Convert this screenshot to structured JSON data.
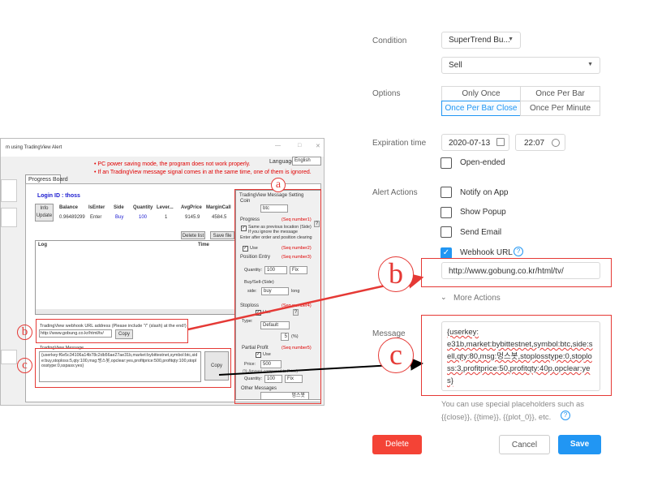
{
  "app": {
    "window_title": "m using TradingView Alert",
    "language_label": "Language:",
    "language_value": "English",
    "warnings": [
      "• PC power saving mode, the program does not work properly.",
      "• If an TradingView message signal comes in at the same time, one of them is ignored."
    ],
    "tab": "Progress Board",
    "login": "Login ID : thoss",
    "info_update": "Info\nUpdate",
    "columns": [
      "Balance",
      "IsEnter",
      "Side",
      "Quantity",
      "Lever...",
      "AvgPrice",
      "MarginCall"
    ],
    "row": [
      "0.96489299",
      "Enter",
      "Buy",
      "100",
      "1",
      "9145.9",
      "4584.5"
    ],
    "delete_list": "Delete list",
    "save_file": "Save file",
    "log_header": "Log",
    "time_header": "Time",
    "webhook_label": "TradingView webhook URL address (Please include \"/\" (slash) at the end!)",
    "webhook_value": "http://www.gobung.co.kr/html/tv/",
    "copy": "Copy",
    "tv_message_label": "TradingView Message",
    "tv_message_value": "{userkey:f6e5c34106a14b78c2db56ae27ae31b,market:bybittestnet,symbol:btc,side:buy,stoploss:5,qty:100,msg:멍스봇,opclear:yes,profitprice:500,profitqty:100,stoplosstype:0,sspass:yes}",
    "copy2": "Copy",
    "settings": {
      "title": "TradingView Message Setting",
      "coin_label": "Coin",
      "coin_value": "btc",
      "progress_label": "Progress",
      "seq1": "(Seq number1)",
      "same_prev": "Same as previous location (Side) If you ignore the message",
      "enter_label": "Enter after order and position clearing",
      "use": "Use",
      "seq2": "(Seq number2)",
      "position_entry": "Position Entry",
      "seq3": "(Seq number3)",
      "quantity_label": "Quantity:",
      "quantity_value": "100",
      "fix": "Fix",
      "buy_sell": "Buy/Sell-(Side)",
      "side_label": "side:",
      "side_value": "buy",
      "long": "long",
      "stoploss": "Stoploss",
      "seq4": "(Seq number4)",
      "type_label": "Type:",
      "type_value": "Default",
      "stop_value": "5",
      "pct": "(%)",
      "partial_profit": "Partial Profit",
      "seq5": "(Seq number5)",
      "price_label": "Price:",
      "price_value": "500",
      "amount_note": "(% Amount compared to Price)",
      "quantity2_value": "100",
      "other_messages": "Other Messages",
      "other_value": "멍스봇",
      "question": "?"
    },
    "markers": {
      "a": "ⓐ",
      "b": "b",
      "c": "c"
    },
    "ctrl_glyphs": [
      "—",
      "□",
      "✕"
    ]
  },
  "form": {
    "condition_label": "Condition",
    "condition_value": "SuperTrend Bu...",
    "condition_action": "Sell",
    "options_label": "Options",
    "options": [
      "Only Once",
      "Once Per Bar",
      "Once Per Bar Close",
      "Once Per Minute"
    ],
    "options_selected": "Once Per Bar Close",
    "expiration_label": "Expiration time",
    "expiration_date": "2020-07-13",
    "expiration_time": "22:07",
    "open_ended": "Open-ended",
    "alert_actions_label": "Alert Actions",
    "actions": [
      {
        "label": "Notify on App",
        "checked": false
      },
      {
        "label": "Show Popup",
        "checked": false
      },
      {
        "label": "Send Email",
        "checked": false
      },
      {
        "label": "Webhook URL",
        "checked": true
      }
    ],
    "webhook_url": "http://www.gobung.co.kr/html/tv/",
    "more_actions": "More Actions",
    "message_label": "Message",
    "message_value": "{userkey:\ne31b,market:bybittestnet,symbol:btc,side:sell,qty:80,msg:멍스봇,stoplosstype:0,stoploss:3,profitprice:50,profitqty:40p,opclear:yes}",
    "hint_line1": "You can use special placeholders such as",
    "hint_line2": "{{close}}, {{time}}, {{plot_0}}, etc.",
    "delete": "Delete",
    "cancel": "Cancel",
    "save": "Save",
    "markers": {
      "b": "b",
      "c": "c"
    }
  },
  "colors": {
    "accent": "#2196f3",
    "danger": "#f44336",
    "annotation": "#e53935"
  }
}
